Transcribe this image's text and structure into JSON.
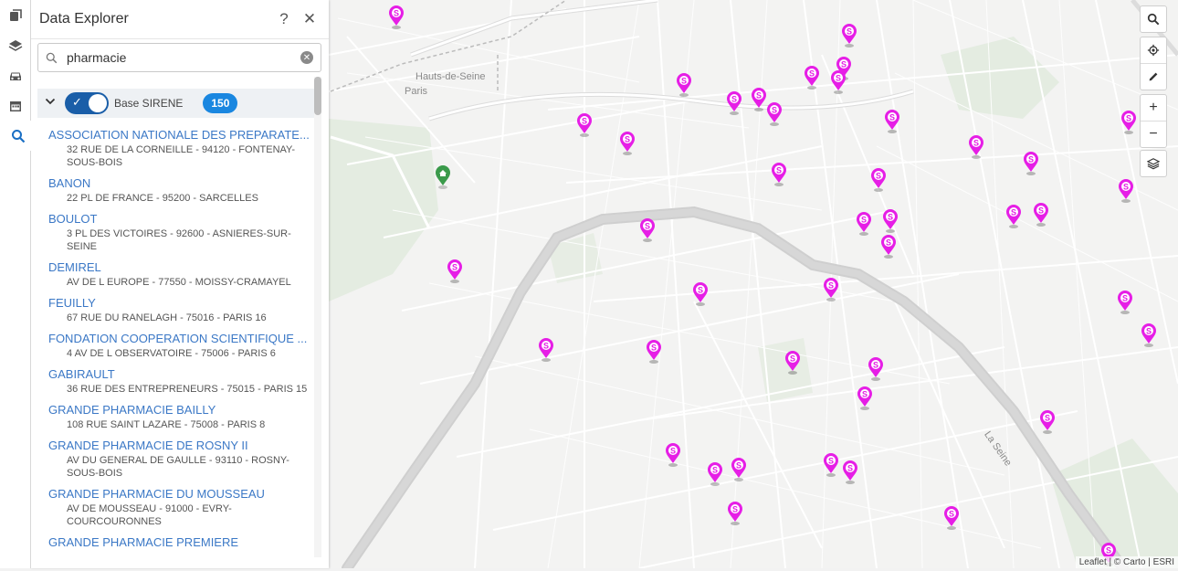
{
  "rail": {
    "items": [
      {
        "icon": "stack-icon",
        "active": false
      },
      {
        "icon": "layers-icon",
        "active": false
      },
      {
        "icon": "car-icon",
        "active": false
      },
      {
        "icon": "calendar-icon",
        "active": false
      },
      {
        "icon": "search-icon",
        "active": true
      }
    ]
  },
  "panel": {
    "title": "Data Explorer",
    "help_icon": "?",
    "close_icon": "✕",
    "search": {
      "value": "pharmacie",
      "placeholder": ""
    },
    "layer": {
      "name": "Base SIRENE",
      "count": "150",
      "enabled": true
    },
    "results": [
      {
        "title": "ASSOCIATION NATIONALE DES PREPARATE...",
        "address": "32 RUE DE LA CORNEILLE - 94120 - FONTENAY-SOUS-BOIS"
      },
      {
        "title": "BANON",
        "address": "22 PL DE FRANCE - 95200 - SARCELLES"
      },
      {
        "title": "BOULOT",
        "address": "3 PL DES VICTOIRES - 92600 - ASNIERES-SUR-SEINE"
      },
      {
        "title": "DEMIREL",
        "address": "AV DE L EUROPE - 77550 - MOISSY-CRAMAYEL"
      },
      {
        "title": "FEUILLY",
        "address": "67 RUE DU RANELAGH - 75016 - PARIS 16"
      },
      {
        "title": "FONDATION COOPERATION SCIENTIFIQUE ...",
        "address": "4 AV DE L OBSERVATOIRE - 75006 - PARIS 6"
      },
      {
        "title": "GABIRAULT",
        "address": "36 RUE DES ENTREPRENEURS - 75015 - PARIS 15"
      },
      {
        "title": "GRANDE PHARMACIE BAILLY",
        "address": "108 RUE SAINT LAZARE - 75008 - PARIS 8"
      },
      {
        "title": "GRANDE PHARMACIE DE ROSNY II",
        "address": "AV DU GENERAL DE GAULLE - 93110 - ROSNY-SOUS-BOIS"
      },
      {
        "title": "GRANDE PHARMACIE DU MOUSSEAU",
        "address": "AV DE MOUSSEAU - 91000 - EVRY-COURCOURONNES"
      },
      {
        "title": "GRANDE PHARMACIE PREMIERE",
        "address": ""
      }
    ]
  },
  "map": {
    "labels": {
      "hauts_de_seine": "Hauts-de-Seine",
      "paris": "Paris",
      "la_seine": "La Seine"
    },
    "marker_letter": "S",
    "marker_color": "#e61ee6",
    "home_color": "#3a9a4a",
    "attribution": "Leaflet | © Carto | ESRI"
  },
  "controls": {
    "zoom_in": "+",
    "zoom_out": "−"
  }
}
